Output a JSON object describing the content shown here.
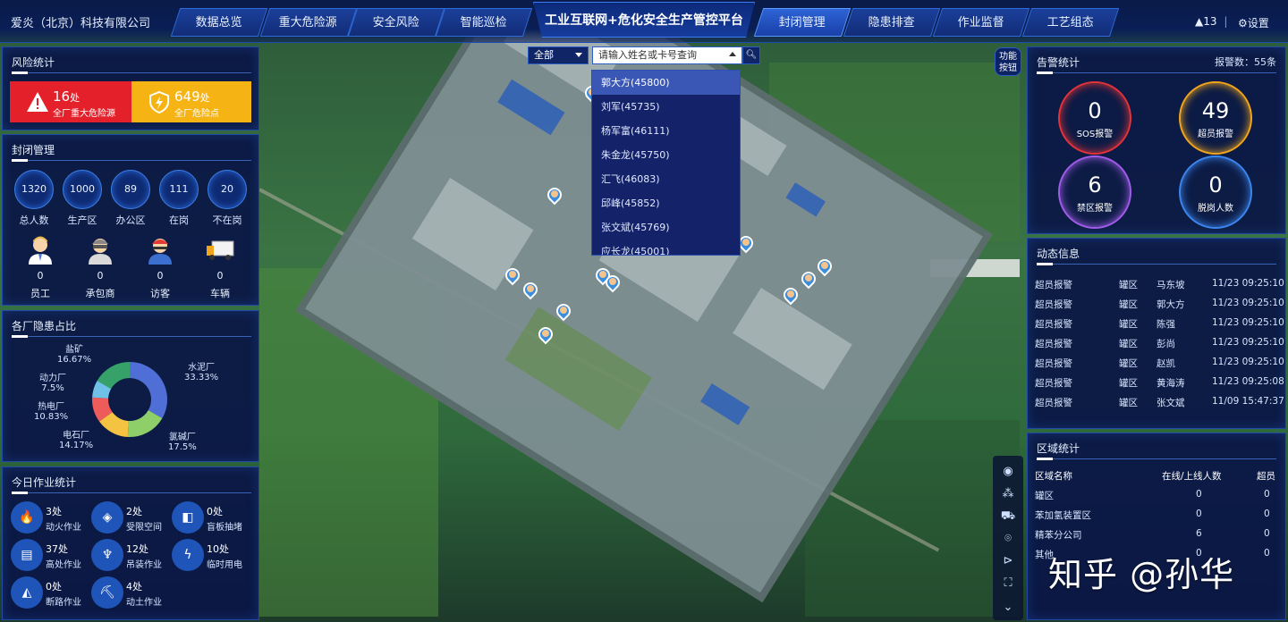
{
  "header": {
    "company": "爱炎（北京）科技有限公司",
    "left_tabs": [
      "数据总览",
      "重大危险源",
      "安全风险",
      "智能巡检"
    ],
    "title": "工业互联网+危化安全生产管控平台",
    "right_tabs": [
      "封闭管理",
      "隐患排查",
      "作业监督",
      "工艺组态"
    ],
    "active_tab": "封闭管理",
    "alert_count": "13",
    "settings_label": "设置"
  },
  "risk": {
    "title": "风险统计",
    "major_value": "16",
    "major_unit": "处",
    "major_label": "全厂重大危险源",
    "total_value": "649",
    "total_unit": "处",
    "total_label": "全厂危险点"
  },
  "closure": {
    "title": "封闭管理",
    "stats": [
      {
        "value": "1320",
        "label": "总人数"
      },
      {
        "value": "1000",
        "label": "生产区"
      },
      {
        "value": "89",
        "label": "办公区"
      },
      {
        "value": "111",
        "label": "在岗"
      },
      {
        "value": "20",
        "label": "不在岗"
      }
    ],
    "people": [
      {
        "value": "0",
        "label": "员工"
      },
      {
        "value": "0",
        "label": "承包商"
      },
      {
        "value": "0",
        "label": "访客"
      },
      {
        "value": "0",
        "label": "车辆"
      }
    ]
  },
  "hazard_share": {
    "title": "各厂隐患占比",
    "chart_data": {
      "type": "pie",
      "slices": [
        {
          "name": "水泥厂",
          "value": 33.33,
          "pct": "33.33%",
          "color": "#4f6fd6"
        },
        {
          "name": "氯碱厂",
          "value": 17.5,
          "pct": "17.5%",
          "color": "#8fcf6a"
        },
        {
          "name": "电石厂",
          "value": 14.17,
          "pct": "14.17%",
          "color": "#f5c342"
        },
        {
          "name": "热电厂",
          "value": 10.83,
          "pct": "10.83%",
          "color": "#ee5b5b"
        },
        {
          "name": "动力厂",
          "value": 7.5,
          "pct": "7.5%",
          "color": "#6fc1e8"
        },
        {
          "name": "盐矿",
          "value": 16.67,
          "pct": "16.67%",
          "color": "#36a26a"
        }
      ]
    }
  },
  "work": {
    "title": "今日作业统计",
    "items": [
      {
        "value": "3处",
        "label": "动火作业",
        "icon": "fire-icon"
      },
      {
        "value": "2处",
        "label": "受限空间",
        "icon": "cube-icon"
      },
      {
        "value": "0处",
        "label": "盲板抽堵",
        "icon": "flag-icon"
      },
      {
        "value": "37处",
        "label": "高处作业",
        "icon": "ladder-icon"
      },
      {
        "value": "12处",
        "label": "吊装作业",
        "icon": "hook-icon"
      },
      {
        "value": "10处",
        "label": "临时用电",
        "icon": "bolt-icon"
      },
      {
        "value": "0处",
        "label": "断路作业",
        "icon": "road-icon"
      },
      {
        "value": "4处",
        "label": "动土作业",
        "icon": "digger-icon"
      }
    ]
  },
  "search": {
    "scope": "全部",
    "placeholder": "请输入姓名或卡号查询",
    "options": [
      "郭大方(45800)",
      "刘军(45735)",
      "杨军富(46111)",
      "朱金龙(45750)",
      "汇飞(46083)",
      "邱峰(45852)",
      "张文斌(45769)",
      "应长龙(45001)"
    ],
    "func_label_1": "功能",
    "func_label_2": "按钮"
  },
  "alarm": {
    "title": "告警统计",
    "count_label": "报警数：55条",
    "rings": [
      {
        "value": "0",
        "label": "SOS报警",
        "color": "#e0333a"
      },
      {
        "value": "49",
        "label": "超员报警",
        "color": "#f0a51c"
      },
      {
        "value": "6",
        "label": "禁区报警",
        "color": "#a05ce8"
      },
      {
        "value": "0",
        "label": "脱岗人数",
        "color": "#3b86ee"
      }
    ]
  },
  "dynamic": {
    "title": "动态信息",
    "rows": [
      {
        "type": "超员报警",
        "area": "罐区",
        "name": "马东坡",
        "time": "11/23 09:25:10"
      },
      {
        "type": "超员报警",
        "area": "罐区",
        "name": "郭大方",
        "time": "11/23 09:25:10"
      },
      {
        "type": "超员报警",
        "area": "罐区",
        "name": "陈强",
        "time": "11/23 09:25:10"
      },
      {
        "type": "超员报警",
        "area": "罐区",
        "name": "彭尚",
        "time": "11/23 09:25:10"
      },
      {
        "type": "超员报警",
        "area": "罐区",
        "name": "赵凯",
        "time": "11/23 09:25:10"
      },
      {
        "type": "超员报警",
        "area": "罐区",
        "name": "黄海涛",
        "time": "11/23 09:25:08"
      },
      {
        "type": "超员报警",
        "area": "罐区",
        "name": "张文斌",
        "time": "11/09 15:47:37"
      }
    ]
  },
  "region": {
    "title": "区域统计",
    "headers": [
      "区域名称",
      "在线/上线人数",
      "超员"
    ],
    "rows": [
      {
        "name": "罐区",
        "online": "0",
        "over": "0"
      },
      {
        "name": "苯加氢装置区",
        "online": "0",
        "over": "0"
      },
      {
        "name": "精苯分公司",
        "online": "6",
        "over": "0"
      },
      {
        "name": "其他",
        "online": "0",
        "over": "0"
      }
    ]
  },
  "watermark": "知乎 @孙华"
}
